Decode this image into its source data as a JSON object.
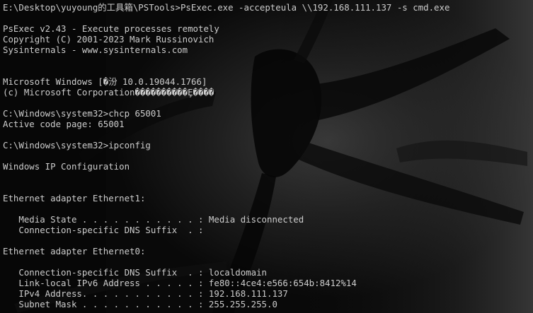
{
  "console": {
    "lines": [
      "E:\\Desktop\\yuyoung的工具箱\\PSTools>PsExec.exe -accepteula \\\\192.168.111.137 -s cmd.exe",
      "",
      "PsExec v2.43 - Execute processes remotely",
      "Copyright (C) 2001-2023 Mark Russinovich",
      "Sysinternals - www.sysinternals.com",
      "",
      "",
      "Microsoft Windows [�汾 10.0.19044.1766]",
      "(c) Microsoft Corporation����������Ȩ����",
      "",
      "C:\\Windows\\system32>chcp 65001",
      "Active code page: 65001",
      "",
      "C:\\Windows\\system32>ipconfig",
      "",
      "Windows IP Configuration",
      "",
      "",
      "Ethernet adapter Ethernet1:",
      "",
      "   Media State . . . . . . . . . . . : Media disconnected",
      "   Connection-specific DNS Suffix  . :",
      "",
      "Ethernet adapter Ethernet0:",
      "",
      "   Connection-specific DNS Suffix  . : localdomain",
      "   Link-local IPv6 Address . . . . . : fe80::4ce4:e566:654b:8412%14",
      "   IPv4 Address. . . . . . . . . . . : 192.168.111.137",
      "   Subnet Mask . . . . . . . . . . . : 255.255.255.0"
    ]
  },
  "colors": {
    "foreground": "#cccccc",
    "background": "#060606"
  }
}
